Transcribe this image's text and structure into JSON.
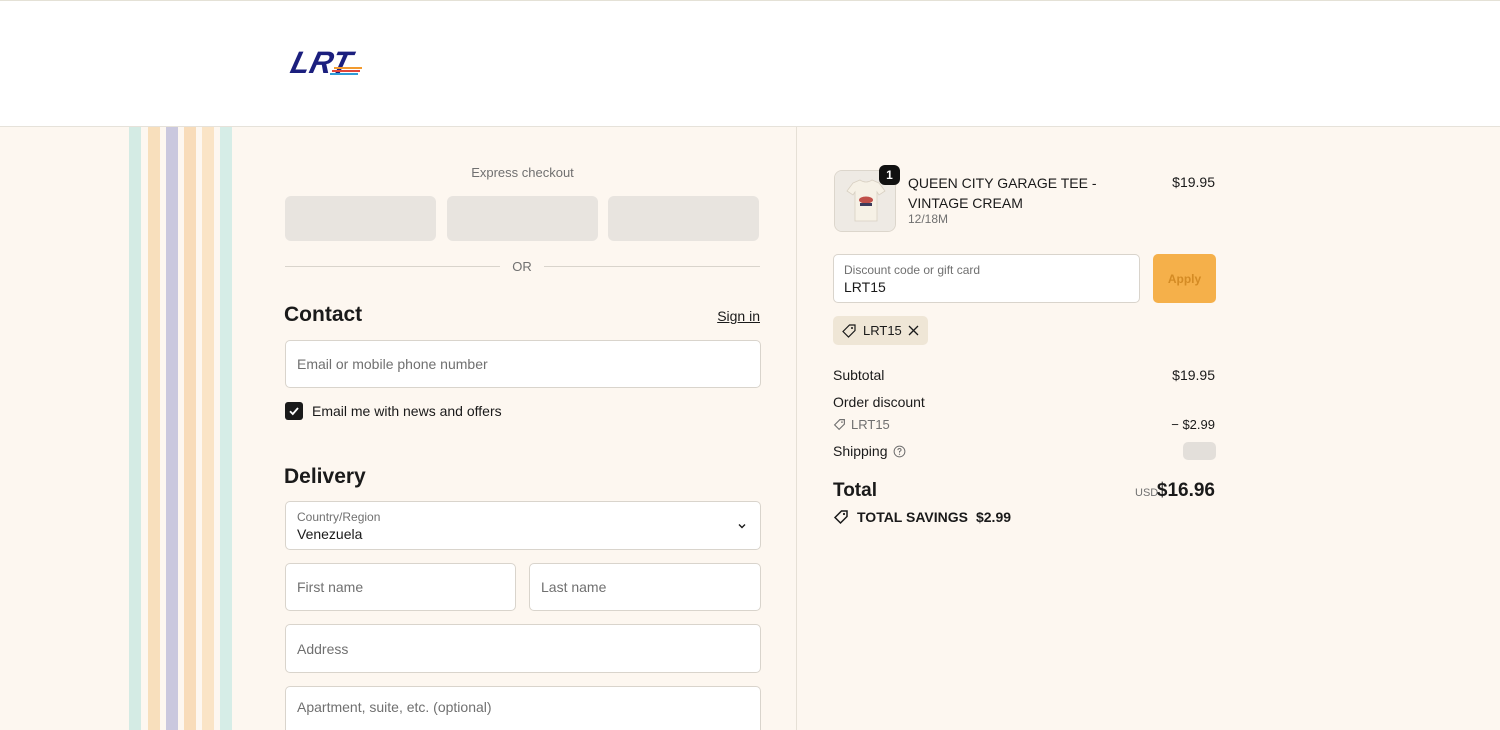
{
  "brand": {
    "logo_text": "LRT",
    "logo_color": "#1b1f7e"
  },
  "express": {
    "title": "Express checkout",
    "or_label": "OR"
  },
  "contact": {
    "title": "Contact",
    "sign_in": "Sign in",
    "email_placeholder": "Email or mobile phone number",
    "newsletter_label": "Email me with news and offers",
    "newsletter_checked": true
  },
  "delivery": {
    "title": "Delivery",
    "country_label": "Country/Region",
    "country_value": "Venezuela",
    "first_name_placeholder": "First name",
    "last_name_placeholder": "Last name",
    "address_placeholder": "Address",
    "apartment_placeholder": "Apartment, suite, etc. (optional)"
  },
  "cart": {
    "item": {
      "quantity": "1",
      "name": "QUEEN CITY GARAGE TEE - VINTAGE CREAM",
      "variant": "12/18M",
      "price": "$19.95"
    },
    "discount": {
      "label": "Discount code or gift card",
      "value": "LRT15",
      "apply_label": "Apply",
      "applied_code": "LRT15"
    },
    "summary": {
      "subtotal_label": "Subtotal",
      "subtotal_value": "$19.95",
      "order_discount_label": "Order discount",
      "discount_code": "LRT15",
      "discount_value": "− $2.99",
      "shipping_label": "Shipping",
      "total_label": "Total",
      "currency": "USD",
      "total_value": "$16.96",
      "savings_label": "TOTAL SAVINGS",
      "savings_value": "$2.99"
    }
  },
  "colors": {
    "accent_button": "#f5b04a",
    "page_bg": "#fdf7f0",
    "stripes": [
      "#cfe9e2",
      "#f7dcb6",
      "#f9e2c1",
      "#c9c7dd",
      "#f7d7b3",
      "#f9e3c4",
      "#d5ece6"
    ]
  }
}
